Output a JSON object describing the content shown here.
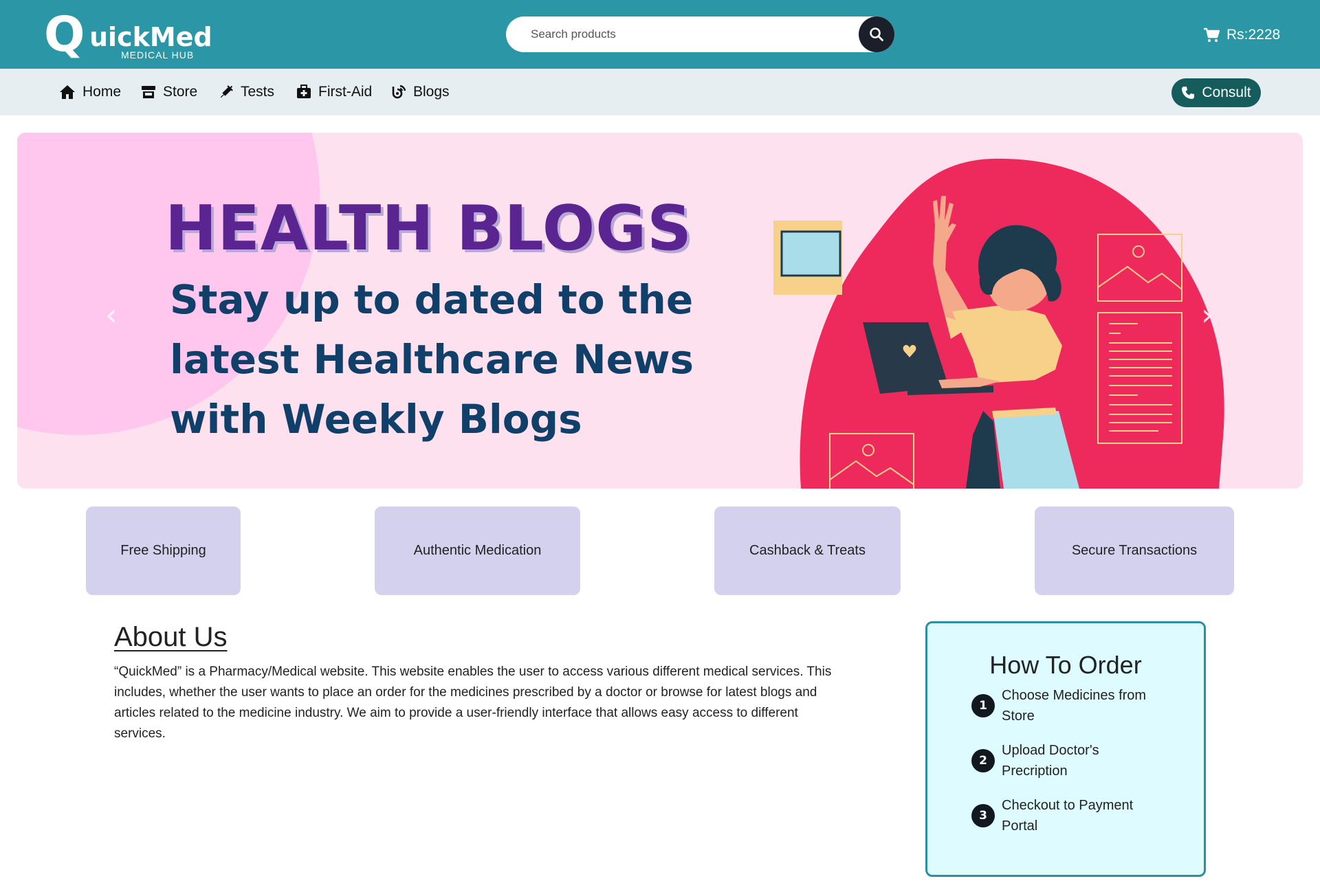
{
  "header": {
    "logo": {
      "main": "uickMed",
      "letter": "Q",
      "sub": "MEDICAL HUB"
    },
    "search": {
      "placeholder": "Search products",
      "icon": "search-icon"
    },
    "cart": {
      "icon": "cart-icon",
      "label": "Rs:2228"
    },
    "colors": {
      "bar": "#2b97a6"
    }
  },
  "nav": {
    "items": [
      {
        "label": "Home",
        "icon": "home-icon"
      },
      {
        "label": "Store",
        "icon": "store-icon"
      },
      {
        "label": "Tests",
        "icon": "syringe-icon"
      },
      {
        "label": "First-Aid",
        "icon": "first-aid-kit-icon"
      },
      {
        "label": "Blogs",
        "icon": "blog-icon"
      }
    ],
    "consult": {
      "label": "Consult",
      "icon": "phone-icon"
    }
  },
  "hero": {
    "title": "HEALTH BLOGS",
    "subtitle_lines": [
      "Stay up to dated to the",
      "latest Healthcare News",
      "with Weekly Blogs"
    ],
    "prev_arrow": "‹",
    "next_arrow": "›"
  },
  "features": [
    {
      "label": "Free Shipping"
    },
    {
      "label": "Authentic Medication"
    },
    {
      "label": "Cashback & Treats"
    },
    {
      "label": "Secure Transactions"
    }
  ],
  "about": {
    "title": "About Us",
    "text": "“QuickMed” is a Pharmacy/Medical website. This website enables the user to access various different medical services. This includes, whether the user wants to place an order for the medicines prescribed by a doctor or browse for latest blogs and articles related to the medicine industry. We aim to provide a user-friendly interface that allows easy access to different services."
  },
  "how_to_order": {
    "title": "How To Order",
    "steps": [
      {
        "num": "1",
        "text": "Choose Medicines from Store"
      },
      {
        "num": "2",
        "text": "Upload Doctor's Precription"
      },
      {
        "num": "3",
        "text": "Checkout to Payment Portal"
      }
    ]
  }
}
